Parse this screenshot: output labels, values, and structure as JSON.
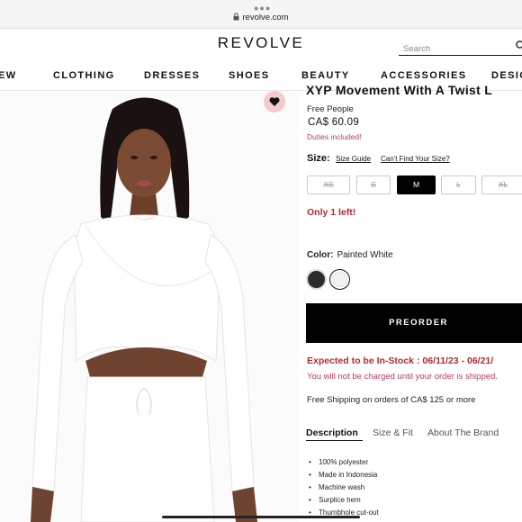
{
  "browser": {
    "url": "revolve.com"
  },
  "header": {
    "logo": "REVOLVE",
    "search_placeholder": "Search"
  },
  "nav": [
    "EW",
    "CLOTHING",
    "DRESSES",
    "SHOES",
    "BEAUTY",
    "ACCESSORIES",
    "DESIG"
  ],
  "product": {
    "title": "XYP Movement With A Twist L",
    "brand": "Free People",
    "price": "CA$ 60.09",
    "duties": "Duties included!"
  },
  "size": {
    "label": "Size:",
    "guide": "Size Guide",
    "cant_find": "Can't Find Your Size?",
    "options": [
      "XS",
      "S",
      "M",
      "L",
      "XL"
    ],
    "selected": "M",
    "stock_note": "Only 1 left!"
  },
  "color": {
    "label": "Color:",
    "value": "Painted White",
    "swatches": [
      {
        "name": "black",
        "hex": "#2c2c2c"
      },
      {
        "name": "painted-white",
        "hex": "#f3f1f2"
      }
    ]
  },
  "actions": {
    "preorder": "PREORDER"
  },
  "shipping_info": {
    "expected": "Expected to be In-Stock : 06/11/23 - 06/21/",
    "charge_note": "You will not be charged until your order is shipped.",
    "free_shipping": "Free Shipping on orders of CA$ 125 or more"
  },
  "tabs": [
    "Description",
    "Size & Fit",
    "About The Brand"
  ],
  "active_tab": "Description",
  "description": [
    "100% polyester",
    "Made in Indonesia",
    "Machine wash",
    "Surplice hem",
    "Thumbhole cut-out"
  ],
  "colors": {
    "accent_red": "#b02a37",
    "duties_pink": "#c0395a",
    "button_black": "#000000",
    "fav_pink": "#f6c9cd"
  }
}
